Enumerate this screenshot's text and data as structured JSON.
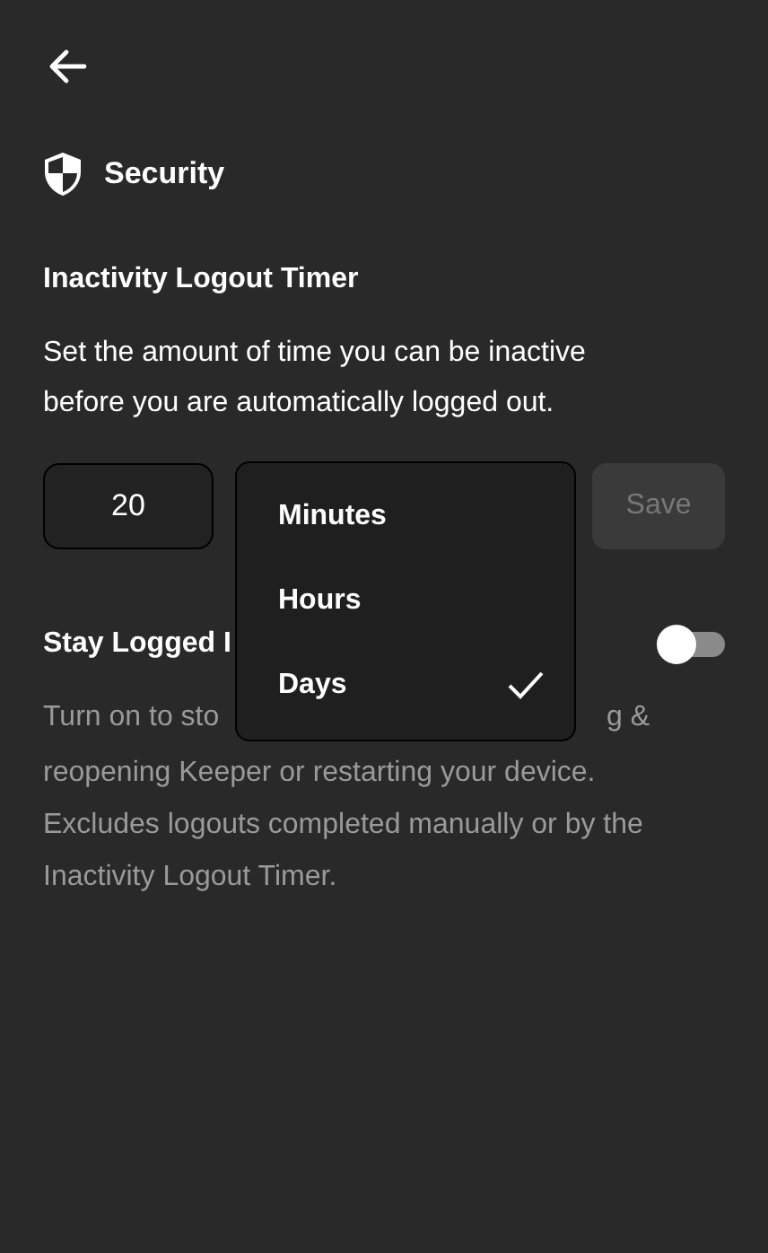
{
  "section": {
    "title": "Security"
  },
  "timer": {
    "title": "Inactivity Logout Timer",
    "description": "Set the amount of time you can be inactive before you are automatically logged out.",
    "amount": "20",
    "save": {
      "label": "Save",
      "disabled": true
    },
    "unit_menu": [
      {
        "label": "Minutes",
        "selected": false
      },
      {
        "label": "Hours",
        "selected": false
      },
      {
        "label": "Days",
        "selected": true
      }
    ]
  },
  "stay_logged_in": {
    "title": "Stay Logged I",
    "on": false,
    "first_line_left": "Turn on to sto",
    "first_line_right": "g &",
    "lines": [
      "reopening Keeper or restarting your device.",
      "Excludes logouts completed manually or by the",
      "Inactivity Logout Timer."
    ]
  }
}
